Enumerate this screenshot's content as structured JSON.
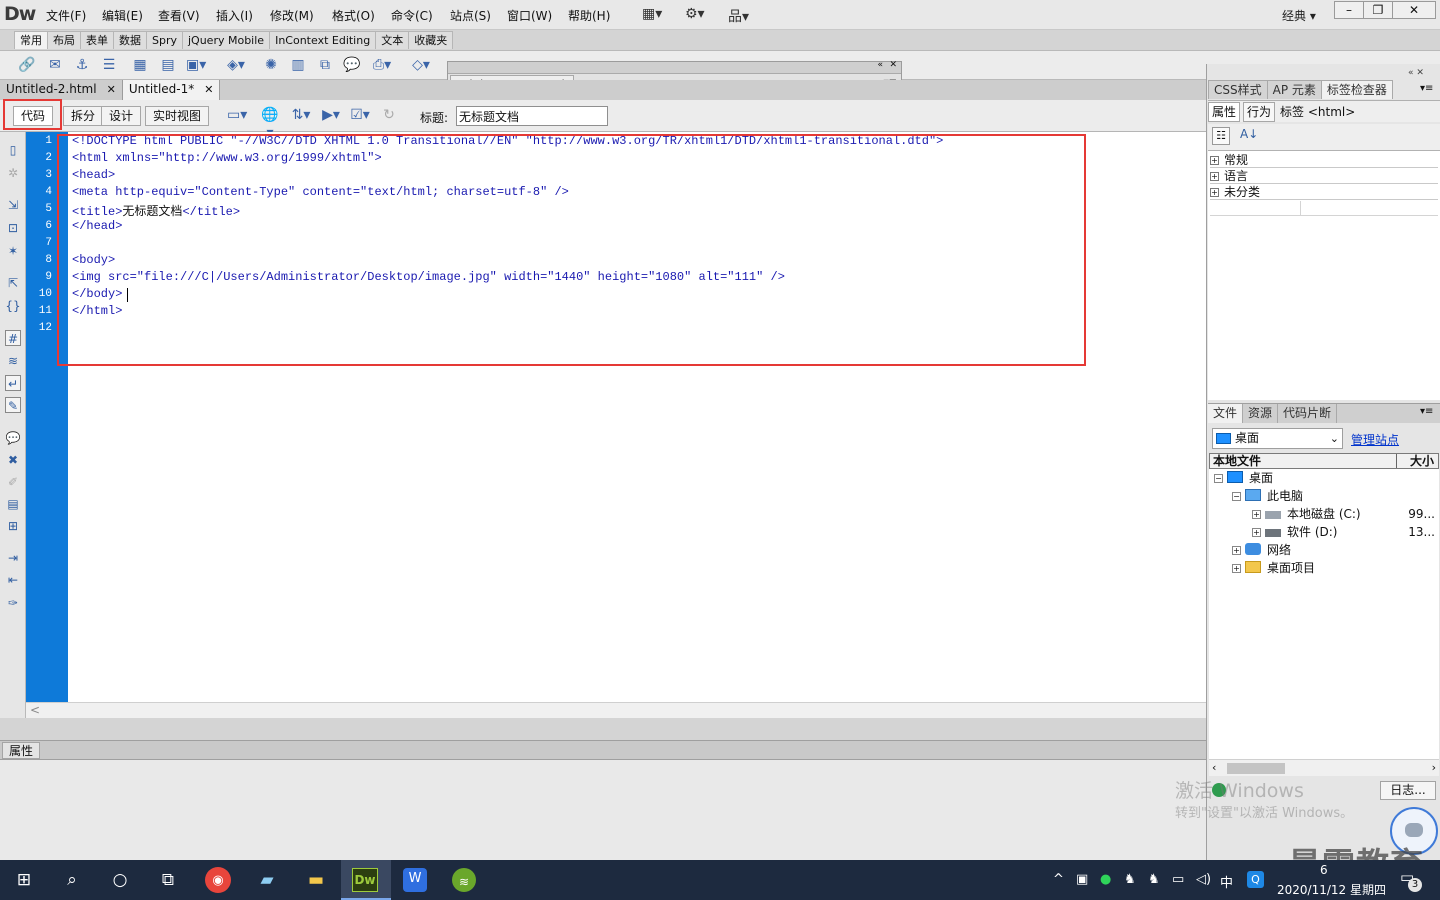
{
  "app": {
    "logo": "Dw",
    "workspace_mode": "经典",
    "menu": [
      "文件(F)",
      "编辑(E)",
      "查看(V)",
      "插入(I)",
      "修改(M)",
      "格式(O)",
      "命令(C)",
      "站点(S)",
      "窗口(W)",
      "帮助(H)"
    ],
    "window_buttons": [
      "–",
      "❐",
      "✕"
    ]
  },
  "insert_bar": {
    "tabs": [
      "常用",
      "布局",
      "表单",
      "数据",
      "Spry",
      "jQuery Mobile",
      "InContext Editing",
      "文本",
      "收藏夹"
    ],
    "active_tab": "常用"
  },
  "browserlab": {
    "title": "Adobe BrowserLab"
  },
  "documents": {
    "tabs": [
      {
        "name": "Untitled-2.html",
        "close": "✕"
      },
      {
        "name": "Untitled-1*",
        "close": "✕"
      }
    ]
  },
  "doc_toolbar": {
    "views": [
      "代码",
      "拆分",
      "设计",
      "实时视图"
    ],
    "active_view": "代码",
    "title_label": "标题:",
    "title_value": "无标题文档"
  },
  "code": {
    "line_numbers": [
      "1",
      "2",
      "3",
      "4",
      "5",
      "6",
      "7",
      "8",
      "9",
      "10",
      "11",
      "12"
    ],
    "lines": [
      "<!DOCTYPE html PUBLIC \"-//W3C//DTD XHTML 1.0 Transitional//EN\" \"http://www.w3.org/TR/xhtml1/DTD/xhtml1-transitional.dtd\">",
      "<html xmlns=\"http://www.w3.org/1999/xhtml\">",
      "<head>",
      "<meta http-equiv=\"Content-Type\" content=\"text/html; charset=utf-8\" />",
      "",
      "</head>",
      "",
      "<body>",
      "<img src=\"file:///C|/Users/Administrator/Desktop/image.jpg\" width=\"1440\" height=\"1080\" alt=\"111\" />",
      "</body>",
      "</html>",
      ""
    ],
    "title_line": {
      "open": "<title>",
      "text": "无标题文档",
      "close": "</title>"
    },
    "scroll_left": "<"
  },
  "properties_panel": {
    "label": "属性"
  },
  "tag_inspector": {
    "tabs": [
      "CSS样式",
      "AP 元素",
      "标签检查器"
    ],
    "active_tab": "标签检查器",
    "subtabs": [
      "属性",
      "行为"
    ],
    "tag_label": "标签 <html>",
    "categories": [
      "常规",
      "语言",
      "未分类"
    ]
  },
  "files_panel": {
    "tabs": [
      "文件",
      "资源",
      "代码片断"
    ],
    "site": "桌面",
    "manage": "管理站点",
    "col_local": "本地文件",
    "col_size": "大小",
    "tree": [
      {
        "label": "桌面",
        "size": ""
      },
      {
        "label": "此电脑",
        "size": ""
      },
      {
        "label": "本地磁盘 (C:)",
        "size": "99..."
      },
      {
        "label": "软件 (D:)",
        "size": "13..."
      },
      {
        "label": "网络",
        "size": ""
      },
      {
        "label": "桌面项目",
        "size": ""
      }
    ],
    "log_button": "日志..."
  },
  "watermark": {
    "activate_title": "激活 Windows",
    "activate_sub": "转到\"设置\"以激活 Windows。",
    "brand": "最需教育"
  },
  "taskbar": {
    "ime": "中",
    "time": "6",
    "date": "2020/11/12 星期四",
    "notifications": "3"
  },
  "colors": {
    "gutter": "#0e7ad9",
    "code_text": "#1a1ab0",
    "highlight_box": "#e53935",
    "taskbar": "#1d2a3f",
    "link": "#0033cc"
  }
}
